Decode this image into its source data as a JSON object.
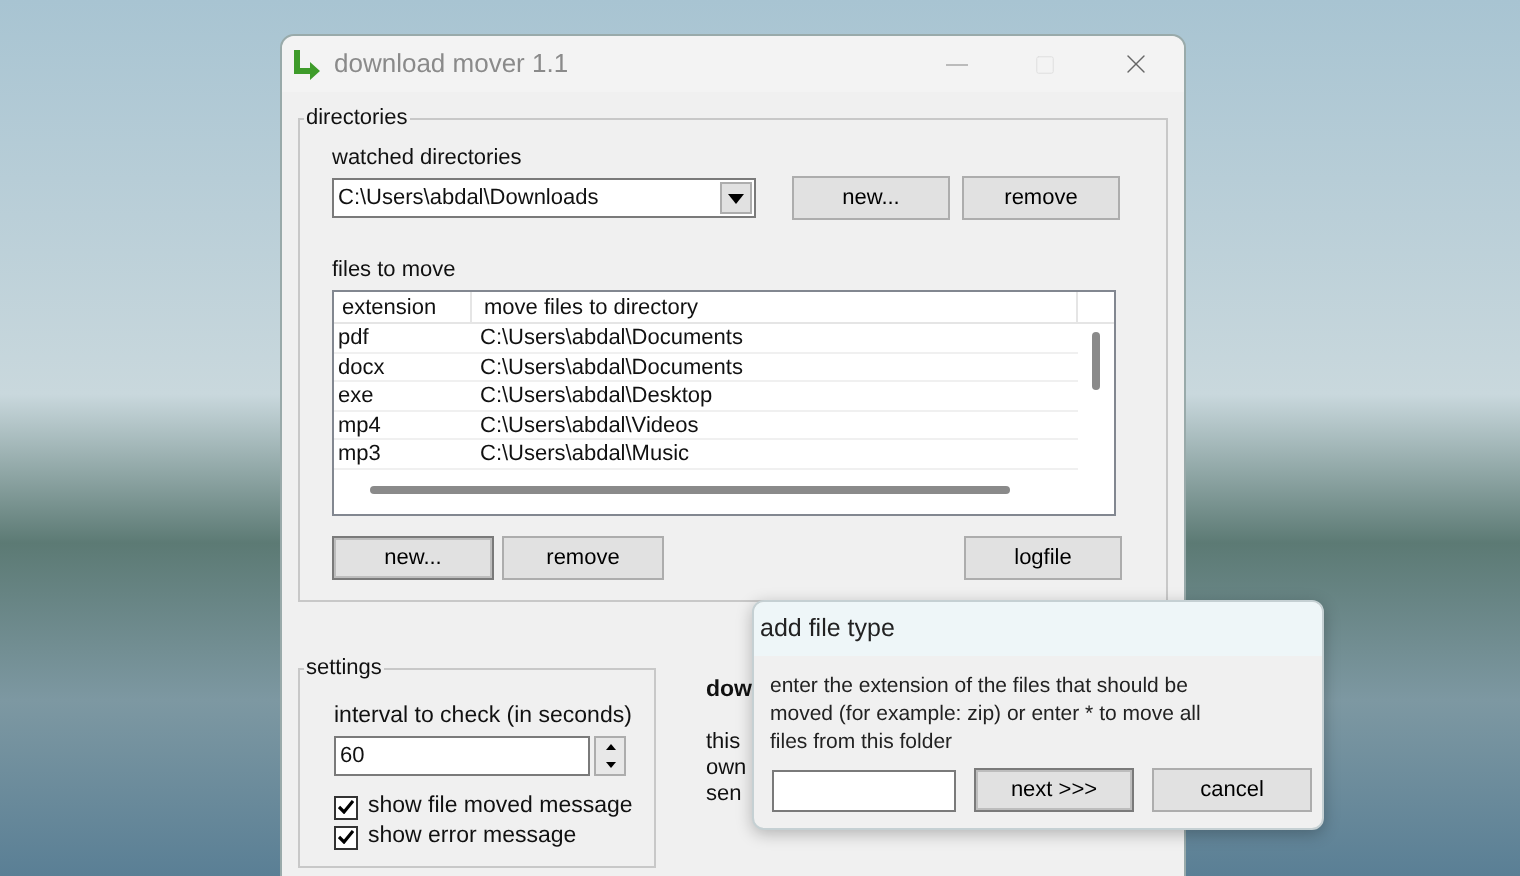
{
  "window": {
    "title": "download mover 1.1"
  },
  "directories": {
    "legend": "directories",
    "watched_label": "watched directories",
    "watched_value": "C:\\Users\\abdal\\Downloads",
    "watched_buttons": [
      "new...",
      "remove"
    ],
    "files_label": "files to move",
    "columns": [
      "extension",
      "move files to directory"
    ],
    "rows": [
      {
        "extension": "pdf",
        "directory": "C:\\Users\\abdal\\Documents"
      },
      {
        "extension": "docx",
        "directory": "C:\\Users\\abdal\\Documents"
      },
      {
        "extension": "exe",
        "directory": "C:\\Users\\abdal\\Desktop"
      },
      {
        "extension": "mp4",
        "directory": "C:\\Users\\abdal\\Videos"
      },
      {
        "extension": "mp3",
        "directory": "C:\\Users\\abdal\\Music"
      }
    ],
    "file_buttons": [
      "new...",
      "remove"
    ],
    "logfile_button": "logfile"
  },
  "settings": {
    "legend": "settings",
    "interval_label": "interval to check (in seconds)",
    "interval_value": "60",
    "options": [
      {
        "label": "show file moved message",
        "checked": true
      },
      {
        "label": "show error message",
        "checked": true
      }
    ]
  },
  "about": {
    "heading": "dow",
    "lines": [
      "this",
      "own",
      "sen"
    ]
  },
  "dialog": {
    "title": "add file type",
    "message": "enter the extension of the files that should be moved (for example: zip) or enter * to move all files from this folder",
    "buttons": [
      "next >>>",
      "cancel"
    ]
  }
}
